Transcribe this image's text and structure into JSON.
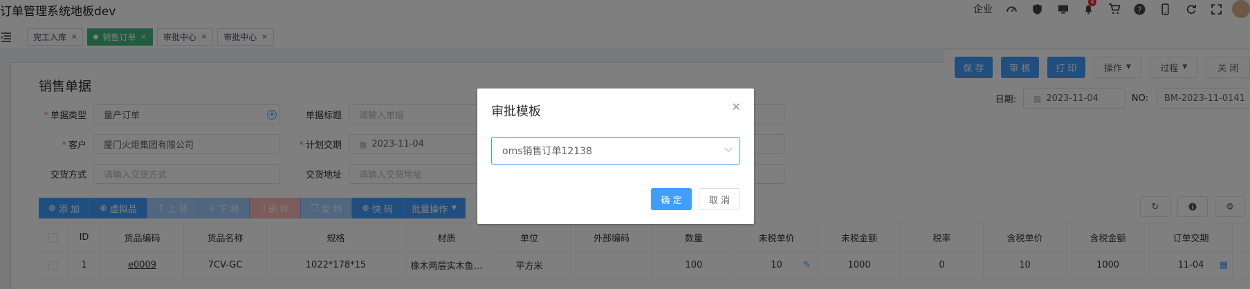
{
  "header": {
    "title": "订单管理系统地板dev",
    "company_label": "企业",
    "notification_count": "4",
    "icons": [
      "dashboard-icon",
      "shield-icon",
      "monitor-icon",
      "bell-icon",
      "cart-icon",
      "help-icon",
      "mobile-icon",
      "refresh-icon",
      "fullscreen-icon"
    ]
  },
  "tabs": [
    {
      "label": "完工入库",
      "active": false
    },
    {
      "label": "销售订单",
      "active": true
    },
    {
      "label": "审批中心",
      "active": false
    },
    {
      "label": "审批中心",
      "active": false
    }
  ],
  "tab_close": "×",
  "page": {
    "title": "销售单据",
    "date_label": "日期:",
    "date_value": "2023-11-04",
    "no_label": "NO:",
    "no_value": "BM-2023-11-0141"
  },
  "toolbar": {
    "save": "保 存",
    "review": "审 核",
    "print": "打 印",
    "operate": "操作",
    "process": "过程",
    "close": "关 闭"
  },
  "form": {
    "doc_type_label": "单据类型",
    "doc_type_value": "量产订单",
    "doc_title_label": "单据标题",
    "doc_title_placeholder": "请输入单据",
    "customer_label": "客户",
    "customer_value": "厦门火炬集团有限公司",
    "plan_date_label": "计划交期",
    "plan_date_value": "2023-11-04",
    "delivery_method_label": "交货方式",
    "delivery_method_placeholder": "请输入交货方式",
    "delivery_address_label": "交货地址",
    "delivery_address_placeholder": "请输入交货地址"
  },
  "actions": {
    "add": "添 加",
    "virtual": "虚拟品",
    "move_up": "上 移",
    "move_down": "下 移",
    "delete": "删 除",
    "copy": "复 制",
    "quick_code": "快 码",
    "batch": "批量操作"
  },
  "table": {
    "columns": [
      "ID",
      "货品编码",
      "货品名称",
      "规格",
      "材质",
      "单位",
      "外部编码",
      "数量",
      "未税单价",
      "未税金额",
      "税率",
      "含税单价",
      "含税金额",
      "订单交期"
    ],
    "rows": [
      {
        "id": "1",
        "code": "e0009",
        "name": "7CV-GC",
        "spec": "1022*178*15",
        "material": "橡木两层实木鱼…",
        "unit": "平方米",
        "ext_code": "",
        "qty": "100",
        "price": "10",
        "amount": "1000",
        "tax_rate": "0",
        "tax_price": "10",
        "tax_amount": "1000",
        "delivery": "11-04"
      }
    ]
  },
  "dialog": {
    "title": "审批模板",
    "selected": "oms销售订单12138",
    "confirm": "确 定",
    "cancel": "取 消"
  }
}
